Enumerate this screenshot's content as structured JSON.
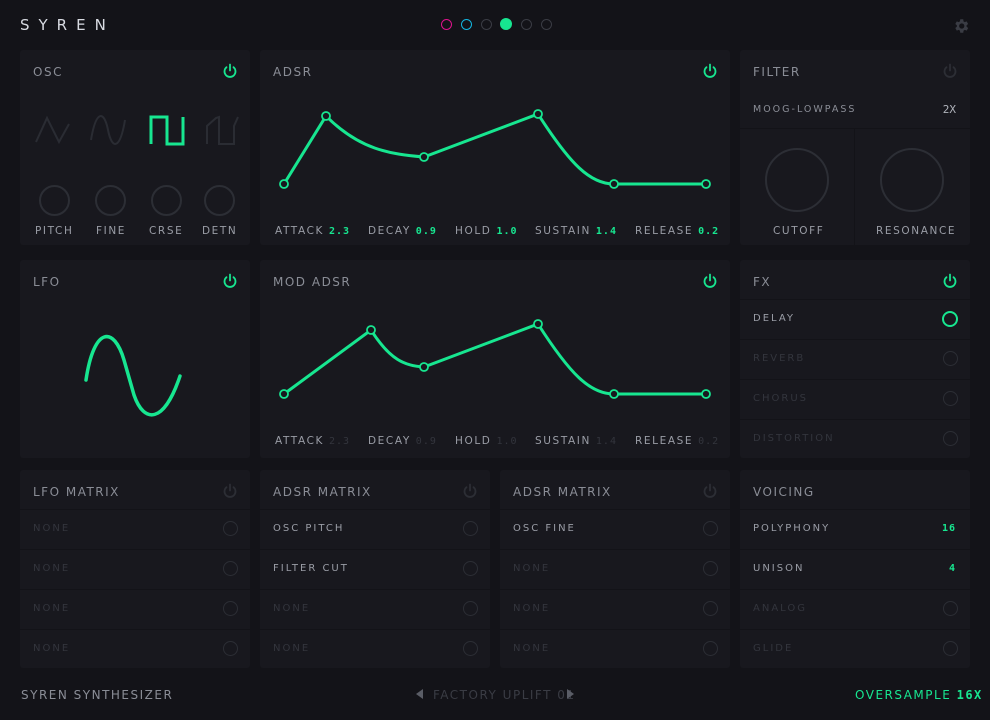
{
  "app": {
    "brand": "SYREN",
    "colors": {
      "accent": "#17e690",
      "magenta": "#e0138c",
      "cyan": "#13b6e0",
      "inactive": "#3a3c44"
    }
  },
  "header": {
    "page_dots": [
      {
        "color": "#e0138c",
        "state": "outline"
      },
      {
        "color": "#13b6e0",
        "state": "outline"
      },
      {
        "color": "#3a3c44",
        "state": "outline"
      },
      {
        "color": "#17e690",
        "state": "filled"
      },
      {
        "color": "#3a3c44",
        "state": "outline"
      },
      {
        "color": "#3a3c44",
        "state": "outline"
      }
    ],
    "settings_icon": "gear-icon"
  },
  "osc": {
    "title": "OSC",
    "waveforms": [
      "saw",
      "sine",
      "square",
      "ramp"
    ],
    "selected_waveform": "square",
    "knobs": [
      "PITCH",
      "FINE",
      "CRSE",
      "DETN"
    ]
  },
  "adsr": {
    "title": "ADSR",
    "params": [
      {
        "label": "ATTACK",
        "value": "2.3"
      },
      {
        "label": "DECAY",
        "value": "0.9"
      },
      {
        "label": "HOLD",
        "value": "1.0"
      },
      {
        "label": "SUSTAIN",
        "value": "1.4"
      },
      {
        "label": "RELEASE",
        "value": "0.2"
      }
    ]
  },
  "filter": {
    "title": "FILTER",
    "type": "MOOG-LOWPASS",
    "mult": "2X",
    "knobs": [
      "CUTOFF",
      "RESONANCE"
    ]
  },
  "lfo": {
    "title": "LFO"
  },
  "mod_adsr": {
    "title": "MOD ADSR",
    "params": [
      {
        "label": "ATTACK",
        "value": "2.3"
      },
      {
        "label": "DECAY",
        "value": "0.9"
      },
      {
        "label": "HOLD",
        "value": "1.0"
      },
      {
        "label": "SUSTAIN",
        "value": "1.4"
      },
      {
        "label": "RELEASE",
        "value": "0.2"
      }
    ]
  },
  "fx": {
    "title": "FX",
    "items": [
      {
        "label": "DELAY",
        "on": true
      },
      {
        "label": "REVERB",
        "on": false
      },
      {
        "label": "CHORUS",
        "on": false
      },
      {
        "label": "DISTORTION",
        "on": false
      }
    ]
  },
  "lfo_matrix": {
    "title": "LFO MATRIX",
    "rows": [
      "NONE",
      "NONE",
      "NONE",
      "NONE"
    ]
  },
  "adsr_matrix_1": {
    "title": "ADSR MATRIX",
    "rows": [
      "OSC PITCH",
      "FILTER CUT",
      "NONE",
      "NONE"
    ]
  },
  "adsr_matrix_2": {
    "title": "ADSR MATRIX",
    "rows": [
      "OSC FINE",
      "NONE",
      "NONE",
      "NONE"
    ]
  },
  "voicing": {
    "title": "VOICING",
    "rows": [
      {
        "label": "POLYPHONY",
        "value": "16"
      },
      {
        "label": "UNISON",
        "value": "4"
      },
      {
        "label": "ANALOG",
        "value": ""
      },
      {
        "label": "GLIDE",
        "value": ""
      }
    ]
  },
  "footer": {
    "left": "SYREN SYNTHESIZER",
    "preset": "FACTORY UPLIFT 01",
    "oversample_label": "OVERSAMPLE",
    "oversample_value": "16X"
  }
}
